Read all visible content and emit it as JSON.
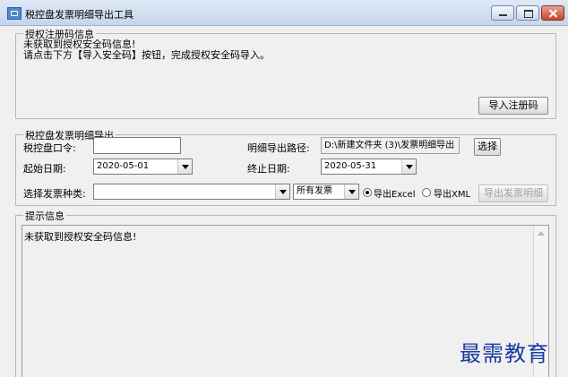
{
  "window": {
    "title": "税控盘发票明细导出工具"
  },
  "auth_group": {
    "legend": "授权注册码信息",
    "line1": "未获取到授权安全码信息!",
    "line2": "请点击下方【导入安全码】按钮，完成授权安全码导入。",
    "import_button": "导入注册码"
  },
  "export_group": {
    "legend": "税控盘发票明细导出",
    "password_label": "税控盘口令:",
    "password_value": "",
    "path_label": "明细导出路径:",
    "path_value": "D:\\新建文件夹 (3)\\发票明细导出",
    "choose_button": "选择",
    "start_label": "起始日期:",
    "start_value": "2020-05-01",
    "end_label": "终止日期:",
    "end_value": "2020-05-31",
    "invoice_type_label": "选择发票种类:",
    "invoice_type_value": "",
    "invoice_filter_value": "所有发票",
    "radio_excel": "导出Excel",
    "radio_xml": "导出XML",
    "export_button": "导出发票明细"
  },
  "hint_group": {
    "legend": "提示信息",
    "message": "未获取到授权安全码信息!"
  },
  "watermark": "最需教育"
}
